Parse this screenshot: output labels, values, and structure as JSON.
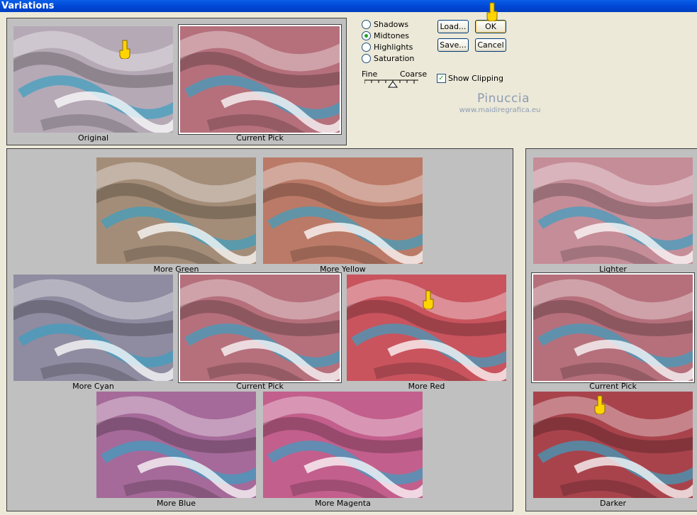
{
  "window": {
    "title": "Variations"
  },
  "top_panel": {
    "labels": {
      "original": "Original",
      "current_pick": "Current Pick"
    }
  },
  "options": {
    "radios": [
      {
        "label": "Shadows",
        "selected": false
      },
      {
        "label": "Midtones",
        "selected": true
      },
      {
        "label": "Highlights",
        "selected": false
      },
      {
        "label": "Saturation",
        "selected": false
      }
    ],
    "slider": {
      "fine": "Fine",
      "coarse": "Coarse"
    },
    "show_clipping": {
      "label": "Show Clipping",
      "checked": true
    }
  },
  "buttons": {
    "load": "Load...",
    "ok": "OK",
    "save": "Save...",
    "cancel": "Cancel"
  },
  "watermark": {
    "name": "Pinuccia",
    "url": "www.maidiregrafica.eu"
  },
  "color_panel": {
    "labels": {
      "more_green": "More Green",
      "more_yellow": "More Yellow",
      "more_cyan": "More Cyan",
      "current_pick": "Current Pick",
      "more_red": "More Red",
      "more_blue": "More Blue",
      "more_magenta": "More Magenta"
    }
  },
  "brightness_panel": {
    "labels": {
      "lighter": "Lighter",
      "current_pick": "Current Pick",
      "darker": "Darker"
    }
  },
  "colors": {
    "original": "#b5a9b6",
    "current_pick": "#b5707c",
    "more_green": "#a48d78",
    "more_yellow": "#bb7a67",
    "more_cyan": "#8f8ba0",
    "more_red": "#c9545e",
    "more_blue": "#a56a99",
    "more_magenta": "#c35f8c",
    "lighter": "#c58d98",
    "darker": "#a8434c",
    "accent": "#3b9fc2"
  }
}
